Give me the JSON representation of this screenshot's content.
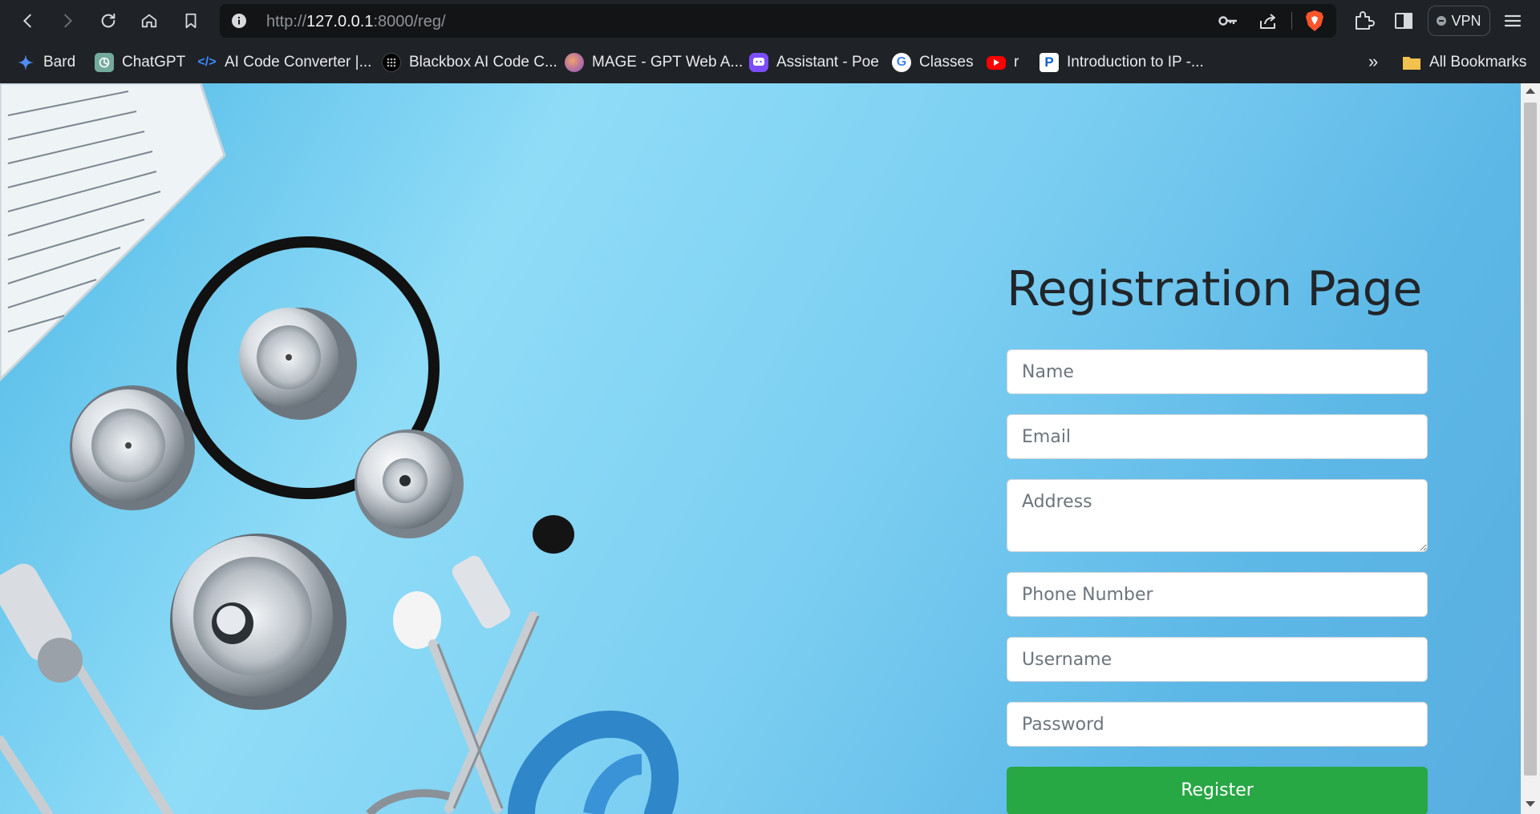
{
  "browser": {
    "url_prefix": "http://",
    "url_host": "127.0.0.1",
    "url_rest": ":8000/reg/",
    "vpn_label": "VPN",
    "bookmarks": [
      {
        "label": "Bard",
        "icon": "bard-icon"
      },
      {
        "label": "ChatGPT",
        "icon": "chatgpt-icon"
      },
      {
        "label": "AI Code Converter |...",
        "icon": "code-icon"
      },
      {
        "label": "Blackbox AI Code C...",
        "icon": "blackbox-icon"
      },
      {
        "label": "MAGE - GPT Web A...",
        "icon": "mage-icon"
      },
      {
        "label": "Assistant - Poe",
        "icon": "poe-icon"
      },
      {
        "label": "Classes",
        "icon": "google-icon"
      },
      {
        "label": "r",
        "icon": "youtube-icon"
      },
      {
        "label": "Introduction to IP -...",
        "icon": "pearson-icon"
      }
    ],
    "overflow_label": "»",
    "all_bookmarks_label": "All Bookmarks"
  },
  "form": {
    "title": "Registration Page",
    "name_placeholder": "Name",
    "email_placeholder": "Email",
    "address_placeholder": "Address",
    "phone_placeholder": "Phone Number",
    "username_placeholder": "Username",
    "password_placeholder": "Password",
    "register_label": "Register"
  },
  "colors": {
    "register_button": "#28a745",
    "background_gradient": "#8fdcf7"
  }
}
